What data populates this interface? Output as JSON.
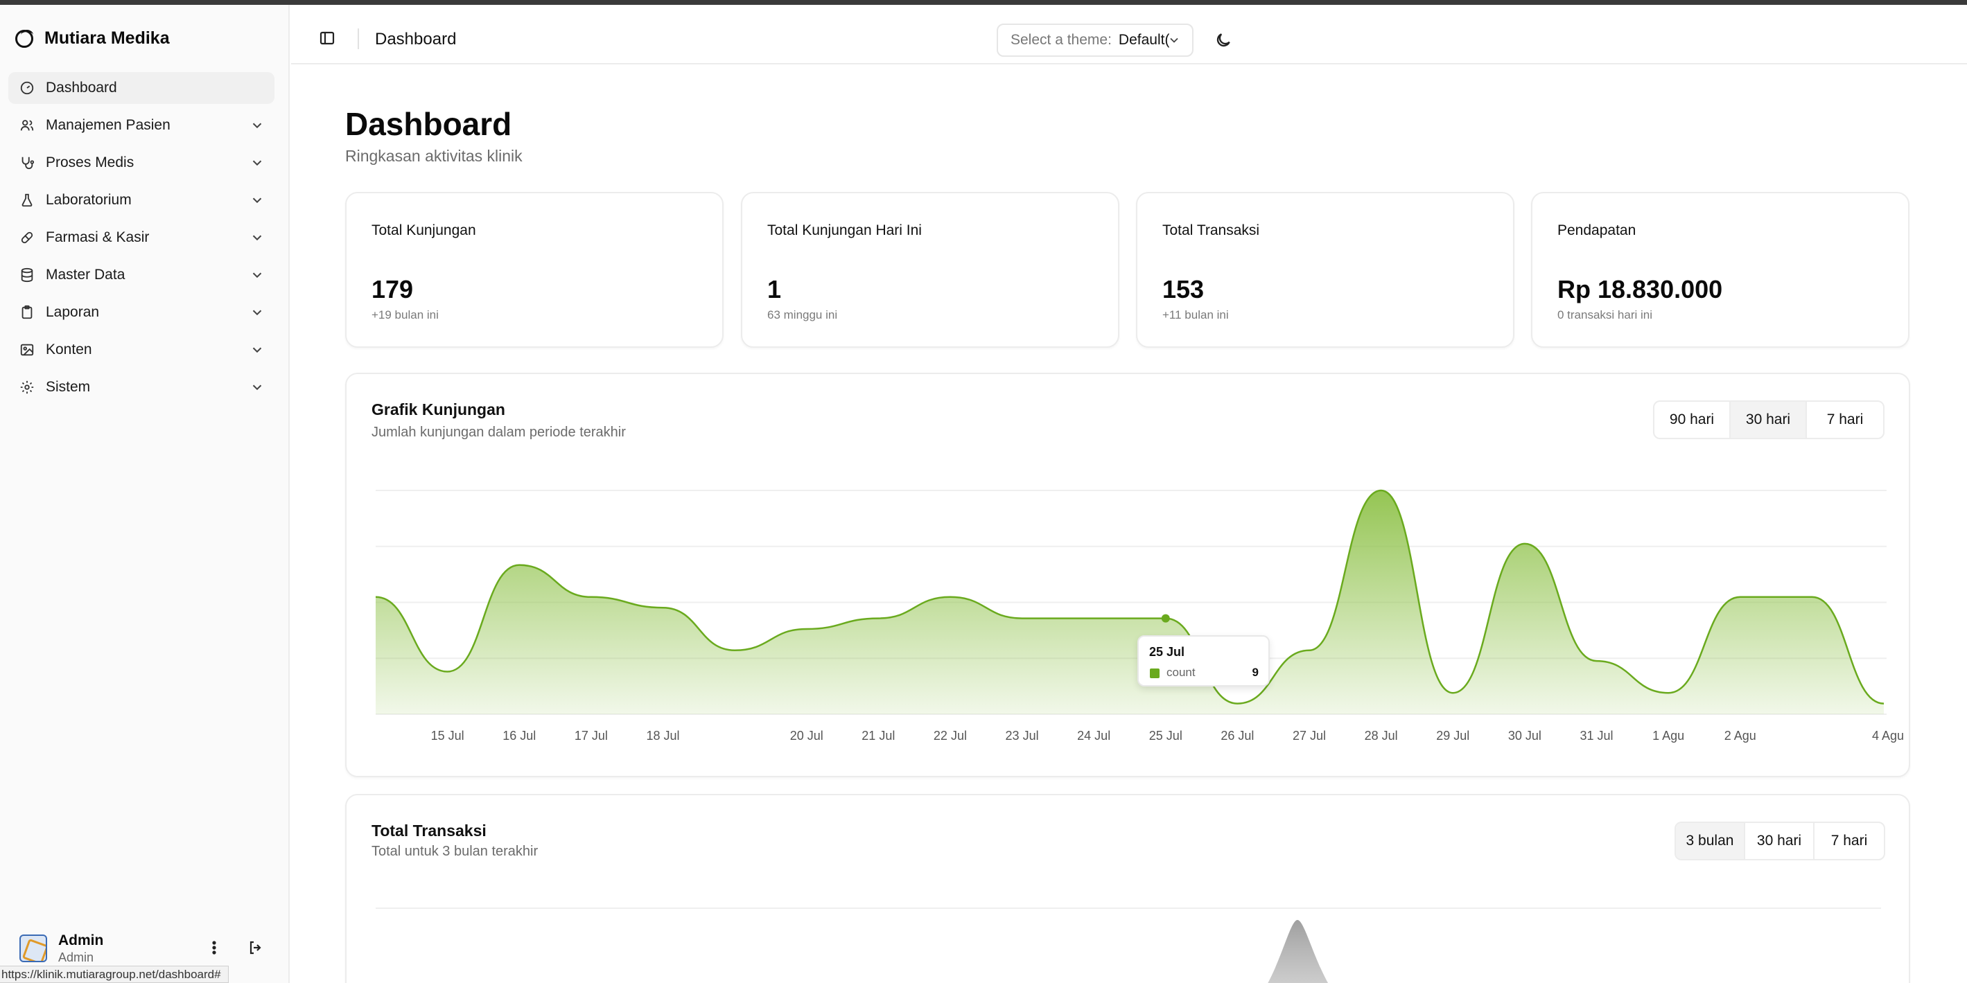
{
  "app": {
    "name": "Mutiara Medika"
  },
  "sidebar": {
    "items": [
      {
        "label": "Dashboard",
        "icon": "gauge-icon",
        "active": true,
        "has_children": false
      },
      {
        "label": "Manajemen Pasien",
        "icon": "users-icon",
        "has_children": true
      },
      {
        "label": "Proses Medis",
        "icon": "stethoscope-icon",
        "has_children": true
      },
      {
        "label": "Laboratorium",
        "icon": "flask-icon",
        "has_children": true
      },
      {
        "label": "Farmasi & Kasir",
        "icon": "pill-icon",
        "has_children": true
      },
      {
        "label": "Master Data",
        "icon": "database-icon",
        "has_children": true
      },
      {
        "label": "Laporan",
        "icon": "clipboard-icon",
        "has_children": true
      },
      {
        "label": "Konten",
        "icon": "image-icon",
        "has_children": true
      },
      {
        "label": "Sistem",
        "icon": "gear-icon",
        "has_children": true
      }
    ],
    "user": {
      "name": "Admin",
      "role": "Admin"
    }
  },
  "status_bar": {
    "url": "https://klinik.mutiaragroup.net/dashboard#"
  },
  "header": {
    "title": "Dashboard",
    "theme_label": "Select a theme:",
    "theme_value": "Default("
  },
  "page": {
    "title": "Dashboard",
    "subtitle": "Ringkasan aktivitas klinik"
  },
  "stats": [
    {
      "label": "Total Kunjungan",
      "value": "179",
      "sub": "+19 bulan ini"
    },
    {
      "label": "Total Kunjungan Hari Ini",
      "value": "1",
      "sub": "63 minggu ini"
    },
    {
      "label": "Total Transaksi",
      "value": "153",
      "sub": "+11 bulan ini"
    },
    {
      "label": "Pendapatan",
      "value": "Rp 18.830.000",
      "sub": "0 transaksi hari ini"
    }
  ],
  "visits_panel": {
    "title": "Grafik Kunjungan",
    "subtitle": "Jumlah kunjungan dalam periode terakhir",
    "ranges": [
      "90 hari",
      "30 hari",
      "7 hari"
    ],
    "active_range": "30 hari",
    "tooltip": {
      "date": "25 Jul",
      "key": "count",
      "value": "9"
    }
  },
  "transactions_panel": {
    "title": "Total Transaksi",
    "subtitle": "Total untuk 3 bulan terakhir",
    "ranges": [
      "3 bulan",
      "30 hari",
      "7 hari"
    ],
    "active_range": "3 bulan"
  },
  "colors": {
    "accent": "#6aaa1e",
    "area_fill": "#9ccb5a",
    "second_chart": "#9a9a9a"
  },
  "chart_data": [
    {
      "type": "area",
      "series": [
        {
          "name": "count",
          "x": [
            "14 Jul",
            "15 Jul",
            "16 Jul",
            "17 Jul",
            "18 Jul",
            "19 Jul",
            "20 Jul",
            "21 Jul",
            "22 Jul",
            "23 Jul",
            "24 Jul",
            "25 Jul",
            "26 Jul",
            "27 Jul",
            "28 Jul",
            "29 Jul",
            "30 Jul",
            "31 Jul",
            "1 Agu",
            "2 Agu",
            "3 Agu",
            "4 Agu"
          ],
          "values": [
            11,
            4,
            14,
            11,
            10,
            6,
            8,
            9,
            11,
            9,
            9,
            9,
            1,
            6,
            21,
            2,
            16,
            5,
            2,
            11,
            11,
            1
          ]
        }
      ],
      "x_tick_labels": [
        "15 Jul",
        "16 Jul",
        "17 Jul",
        "18 Jul",
        "20 Jul",
        "21 Jul",
        "22 Jul",
        "23 Jul",
        "24 Jul",
        "25 Jul",
        "26 Jul",
        "27 Jul",
        "28 Jul",
        "29 Jul",
        "30 Jul",
        "31 Jul",
        "1 Agu",
        "2 Agu",
        "4 Agu"
      ],
      "ylim": [
        0,
        21
      ],
      "grid": true,
      "highlight": {
        "x": "25 Jul",
        "value": 9
      }
    }
  ]
}
